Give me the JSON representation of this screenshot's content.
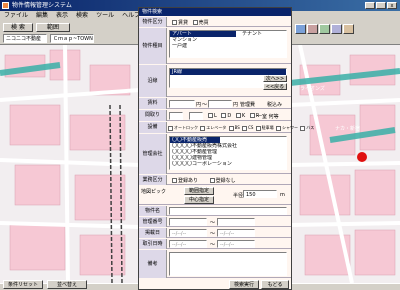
{
  "window": {
    "title": "物件情報管理システム"
  },
  "menu": [
    "ファイル",
    "編集",
    "表示",
    "検索",
    "ツール",
    "ヘルプ"
  ],
  "toolbar": {
    "search_btn": "検 索",
    "area_btn": "範囲",
    "shop_select": "ニコニコ不動産",
    "town_field": "Ｃｍａｐ~TOWN"
  },
  "map_labels": [
    "ナカ・新宿",
    "ライオンズ"
  ],
  "dialog": {
    "title": "物件検索",
    "rows": {
      "kind": "物件区分",
      "type": "物件種目",
      "route": "沿線",
      "rent": "賃料",
      "layout": "間取り",
      "equip": "設備",
      "company": "管理会社",
      "register": "業務区分",
      "map": "地図ピック",
      "name": "物件名",
      "mgmt": "管理番号",
      "date": "掲載日",
      "update": "取引日時",
      "note": "備考"
    },
    "kind_opts": [
      "賃貸",
      "売買"
    ],
    "type_items": [
      "アパート",
      "マンション",
      "一戸建"
    ],
    "type_extra": "テナント",
    "route_items": [
      "JR線"
    ],
    "route_btn_next": "次へ>>",
    "route_btn_prev": "<<戻る",
    "rent": {
      "unit1": "円",
      "sep": "～",
      "unit2": "円",
      "mgmt_lbl": "管理費",
      "tax_lbl": "税込み"
    },
    "layout": {
      "opts": [
        "L",
        "D",
        "K",
        "R"
      ],
      "right": [
        "一室",
        "何等"
      ]
    },
    "equip": {
      "opts": [
        "オートロック",
        "エレベータ",
        "BS",
        "CS",
        "駐車場",
        "シャワー",
        "バス"
      ]
    },
    "company_items": [
      "〇〇不動産販売",
      "〇〇〇〇不動産販売株式会社",
      "〇〇〇〇不動産管理",
      "〇〇〇〇建物管理",
      "〇〇〇〇コーポレーション"
    ],
    "register_opts": [
      "登録あり",
      "登録なし"
    ],
    "map_btn1": "範囲指定",
    "map_btn2": "中心指定",
    "radius_lbl": "半径",
    "radius_val": "150",
    "radius_unit": "m",
    "date_sep": "～",
    "date_ph": "--/--/--",
    "footer": {
      "reset": "条件リセット",
      "sort": "並べ替え",
      "run": "検索実行",
      "close": "もどる"
    }
  }
}
